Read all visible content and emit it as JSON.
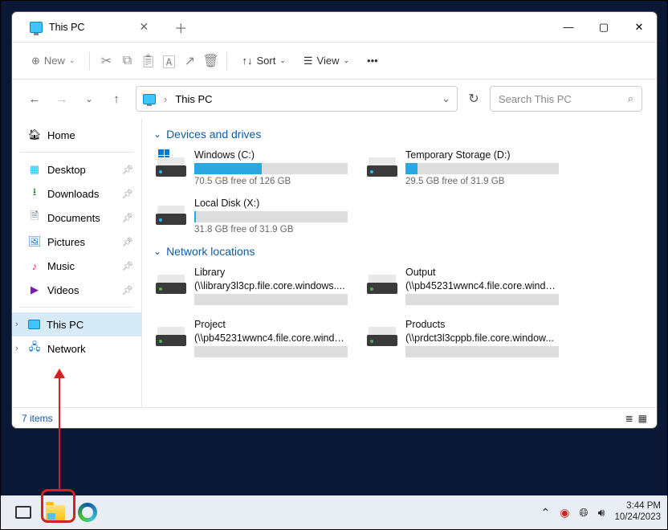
{
  "tab": {
    "title": "This PC"
  },
  "toolbar": {
    "new": "New",
    "sort": "Sort",
    "view": "View"
  },
  "address": {
    "path": "This PC"
  },
  "search": {
    "placeholder": "Search This PC"
  },
  "sidebar": {
    "home": "Home",
    "quick": [
      {
        "label": "Desktop"
      },
      {
        "label": "Downloads"
      },
      {
        "label": "Documents"
      },
      {
        "label": "Pictures"
      },
      {
        "label": "Music"
      },
      {
        "label": "Videos"
      }
    ],
    "thispc": "This PC",
    "network": "Network"
  },
  "groups": {
    "drives_header": "Devices and drives",
    "network_header": "Network locations"
  },
  "drives": [
    {
      "name": "Windows (C:)",
      "free": "70.5 GB free of 126 GB",
      "fill": 44,
      "led": "blue",
      "winlogo": true
    },
    {
      "name": "Temporary Storage (D:)",
      "free": "29.5 GB free of 31.9 GB",
      "fill": 8,
      "led": "blue"
    },
    {
      "name": "Local Disk (X:)",
      "free": "31.8 GB free of 31.9 GB",
      "fill": 1,
      "led": "blue"
    }
  ],
  "netloc": [
    {
      "name": "Library",
      "path": "(\\\\library3l3cp.file.core.windows....",
      "led": "green"
    },
    {
      "name": "Output",
      "path": "(\\\\pb45231wwnc4.file.core.windo...",
      "led": "green"
    },
    {
      "name": "Project",
      "path": "(\\\\pb45231wwnc4.file.core.windo...",
      "led": "green"
    },
    {
      "name": "Products",
      "path": "(\\\\prdct3l3cppb.file.core.window...",
      "led": "green"
    }
  ],
  "status": {
    "count": "7 items"
  },
  "clock": {
    "time": "3:44 PM",
    "date": "10/24/2023"
  }
}
